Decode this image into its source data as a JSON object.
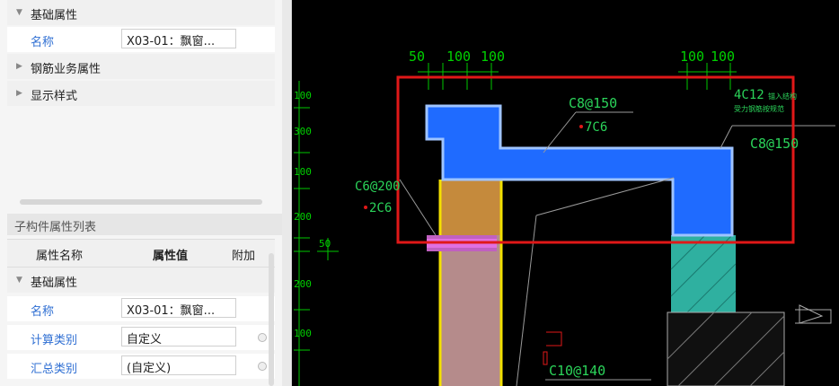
{
  "properties_panel": {
    "basic_group": "基础属性",
    "name_label": "名称",
    "name_value": "X03-01：飘窗...",
    "rebar_group": "钢筋业务属性",
    "display_group": "显示样式"
  },
  "sub_component_panel": {
    "title": "子构件属性列表",
    "col_name": "属性名称",
    "col_value": "属性值",
    "col_extra": "附加",
    "basic_group": "基础属性",
    "rows": [
      {
        "label": "名称",
        "value": "X03-01：飘窗..."
      },
      {
        "label": "计算类别",
        "value": "自定义"
      },
      {
        "label": "汇总类别",
        "value": "(自定义)"
      }
    ]
  },
  "cad": {
    "dims_top_left": [
      "50",
      "100",
      "100"
    ],
    "dims_top_right": [
      "100",
      "100"
    ],
    "dims_left": [
      "100",
      "300",
      "100",
      "200",
      "50",
      "200",
      "100"
    ],
    "labels": {
      "c8_150_a": "C8@150",
      "c6_7": "7C6",
      "c12": "4C12",
      "note_a": "锚入结构",
      "note_b": "受力钢筋按规范",
      "c8_150_b": "C8@150",
      "c6_200": "C6@200",
      "c6_2": "2C6",
      "c10_140": "C10@140"
    },
    "colors": {
      "background": "#000000",
      "slab": "#1f6bff",
      "highlight_box": "#e01818",
      "dimension": "#00d000",
      "annotation": "#2bd45a"
    }
  }
}
